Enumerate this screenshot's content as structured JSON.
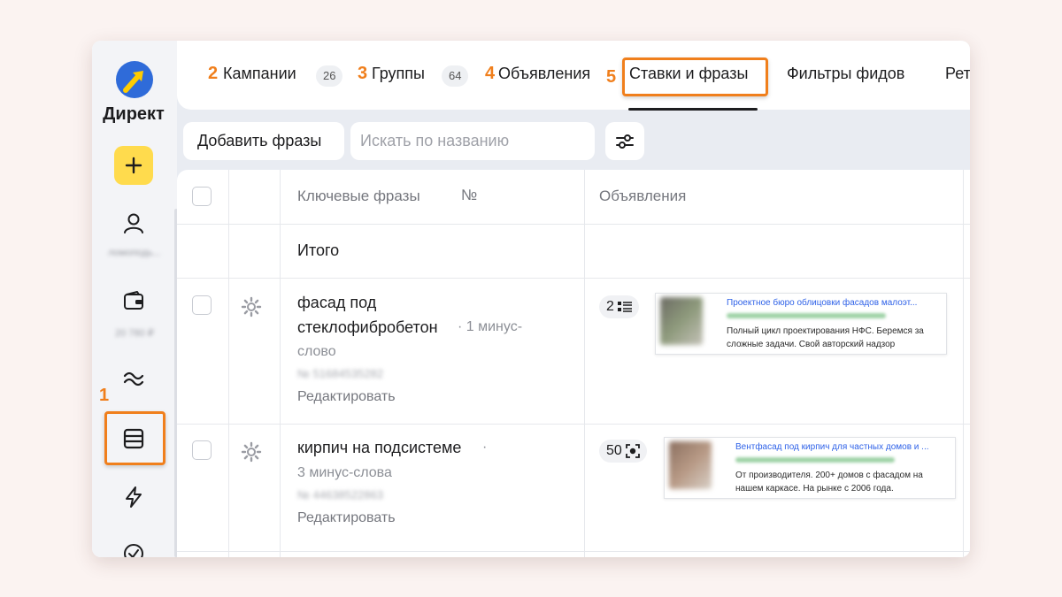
{
  "sidebar": {
    "brand": "Директ",
    "account_label": "ломоподь...",
    "balance_label": "20 780 ₽"
  },
  "callouts": {
    "sidebar_step": "1",
    "campaigns_step": "2",
    "groups_step": "3",
    "ads_step": "4",
    "bids_step": "5"
  },
  "tabs": {
    "campaigns": {
      "label": "Кампании",
      "count": "26"
    },
    "groups": {
      "label": "Группы",
      "count": "64"
    },
    "ads": {
      "label": "Объявления"
    },
    "bids": {
      "label": "Ставки и фразы"
    },
    "feed_filters": {
      "label": "Фильтры фидов"
    },
    "retargeting": {
      "label": "Рет"
    }
  },
  "toolbar": {
    "add_phrases": "Добавить фразы",
    "search_placeholder": "Искать по названию"
  },
  "table": {
    "headers": {
      "phrases": "Ключевые фразы",
      "number": "№",
      "ads": "Объявления"
    },
    "total_label": "Итого",
    "rows": [
      {
        "phrase_line1": "фасад под",
        "phrase_line2": "стеклофибробетон",
        "minus_part1": "· 1 минус-",
        "minus_part2": "слово",
        "id_blurred": "№ 51684535282",
        "edit": "Редактировать",
        "ads_count": "2",
        "ad": {
          "title": "Проектное бюро облицовки фасадов малоэт...",
          "text_line1": "Полный цикл проектирования НФС. Беремся за",
          "text_line2": "сложные задачи. Свой авторский надзор"
        }
      },
      {
        "phrase_line1": "кирпич на подсистеме",
        "phrase_dot": "·",
        "minus": "3 минус-слова",
        "id_blurred": "№ 44638522863",
        "edit": "Редактировать",
        "ads_count": "50",
        "ad": {
          "title": "Вентфасад под кирпич для частных домов и ...",
          "text_line1": "От производителя. 200+ домов с фасадом на",
          "text_line2": "нашем каркасе. На рынке с 2006 года."
        }
      }
    ]
  }
}
